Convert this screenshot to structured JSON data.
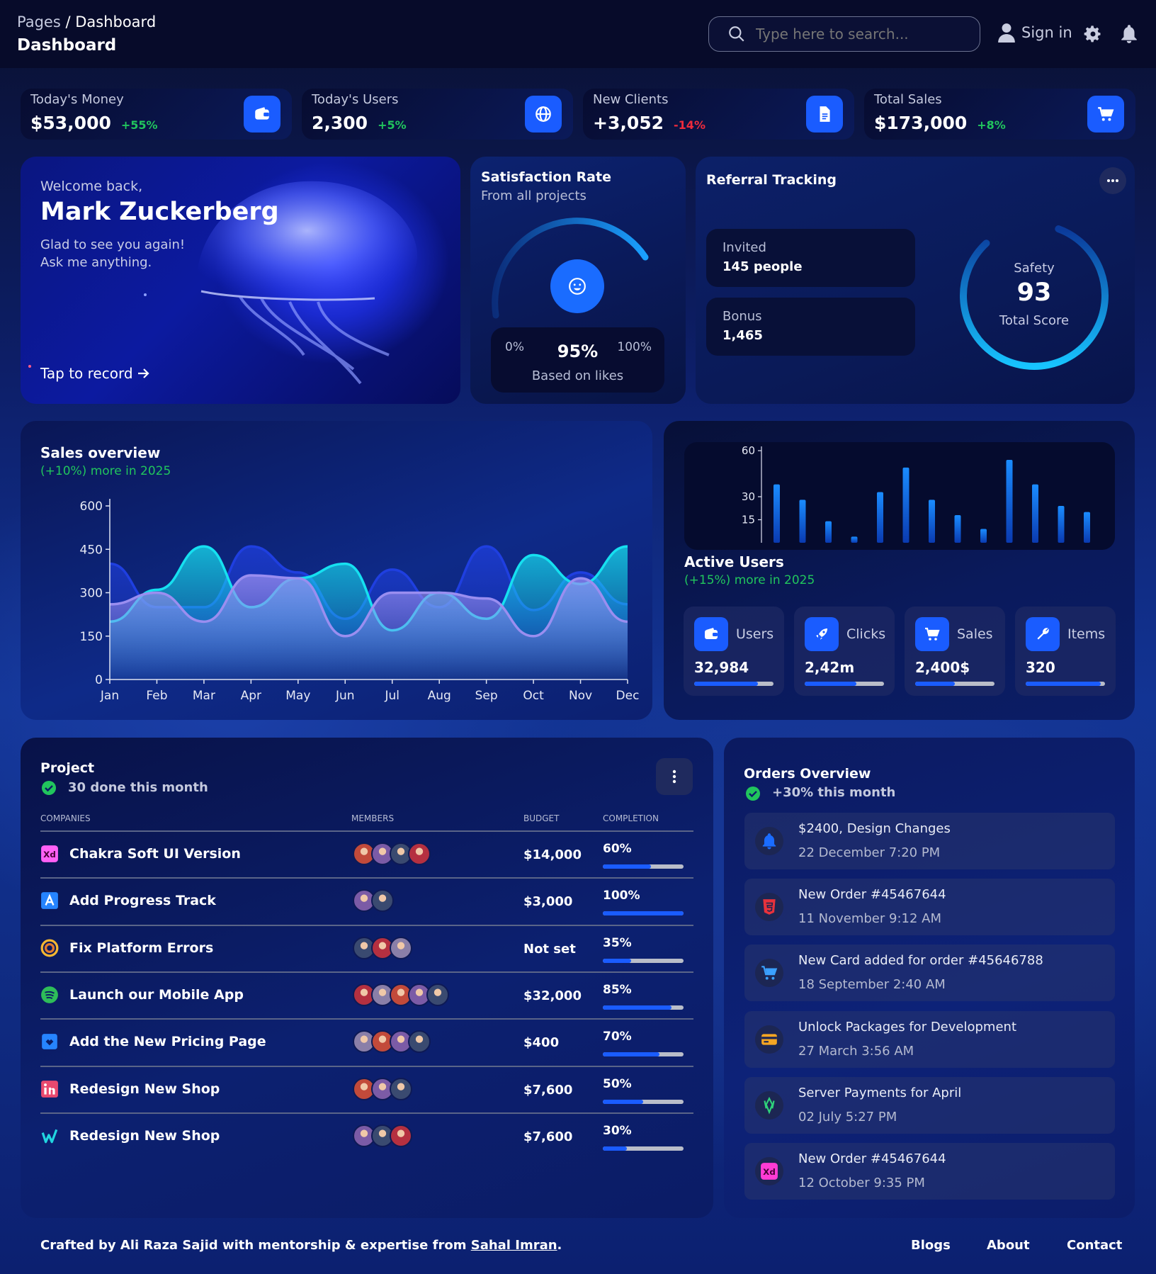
{
  "header": {
    "breadcrumb_parent": "Pages",
    "breadcrumb_sep": " / ",
    "breadcrumb_current": "Dashboard",
    "page_title": "Dashboard",
    "search_placeholder": "Type here to search...",
    "sign_in": "Sign in"
  },
  "kpis": [
    {
      "label": "Today's Money",
      "value": "$53,000",
      "change": "+55%",
      "trend": "up",
      "icon": "wallet-icon"
    },
    {
      "label": "Today's Users",
      "value": "2,300",
      "change": "+5%",
      "trend": "up",
      "icon": "globe-icon"
    },
    {
      "label": "New Clients",
      "value": "+3,052",
      "change": "-14%",
      "trend": "down",
      "icon": "document-icon"
    },
    {
      "label": "Total Sales",
      "value": "$173,000",
      "change": "+8%",
      "trend": "up",
      "icon": "cart-icon"
    }
  ],
  "welcome": {
    "greeting": "Welcome back,",
    "name": "Mark Zuckerberg",
    "line1": "Glad to see you again!",
    "line2": "Ask me anything.",
    "cta": "Tap to record"
  },
  "satisfaction": {
    "title": "Satisfaction Rate",
    "subtitle": "From all projects",
    "min": "0%",
    "value": "95%",
    "max": "100%",
    "caption": "Based on likes",
    "level": 0.95
  },
  "referral": {
    "title": "Referral Tracking",
    "invited_label": "Invited",
    "invited_value": "145 people",
    "bonus_label": "Bonus",
    "bonus_value": "1,465",
    "score_label": "Safety",
    "score": "93",
    "score_caption": "Total Score",
    "score_level": 0.93
  },
  "sales": {
    "title": "Sales overview",
    "subtitle": "(+10%) more in 2025"
  },
  "active": {
    "title": "Active Users",
    "subtitle": "(+15%) more in 2025",
    "stats": [
      {
        "label": "Users",
        "value": "32,984",
        "level": 0.8,
        "icon": "wallet-icon"
      },
      {
        "label": "Clicks",
        "value": "2,42m",
        "level": 0.65,
        "icon": "rocket-icon"
      },
      {
        "label": "Sales",
        "value": "2,400$",
        "level": 0.5,
        "icon": "cart-icon"
      },
      {
        "label": "Items",
        "value": "320",
        "level": 0.95,
        "icon": "wrench-icon"
      }
    ]
  },
  "chart_data": [
    {
      "type": "area",
      "categories": [
        "Jan",
        "Feb",
        "Mar",
        "Apr",
        "May",
        "Jun",
        "Jul",
        "Aug",
        "Sep",
        "Oct",
        "Nov",
        "Dec"
      ],
      "ylim": [
        0,
        600
      ],
      "yticks": [
        0,
        150,
        300,
        450,
        600
      ],
      "series": [
        {
          "values": [
            400,
            250,
            250,
            460,
            370,
            210,
            380,
            250,
            460,
            240,
            370,
            260
          ],
          "color": "#1f3fe0"
        },
        {
          "values": [
            200,
            310,
            460,
            250,
            350,
            400,
            170,
            300,
            210,
            430,
            330,
            460
          ],
          "color": "#16e0f0"
        },
        {
          "values": [
            260,
            300,
            200,
            360,
            350,
            150,
            300,
            300,
            280,
            150,
            350,
            200
          ],
          "color": "#9a8ef0"
        }
      ]
    },
    {
      "type": "bar",
      "ylim": [
        0,
        60
      ],
      "yticks": [
        15,
        30,
        60
      ],
      "values": [
        38,
        28,
        14,
        4,
        33,
        49,
        28,
        18,
        9,
        54,
        38,
        24,
        20
      ],
      "color": "#1a7cff"
    }
  ],
  "projects": {
    "title": "Project",
    "subtitle": "30 done this month",
    "headers": [
      "COMPANIES",
      "MEMBERS",
      "BUDGET",
      "COMPLETION"
    ],
    "rows": [
      {
        "name": "Chakra Soft UI Version",
        "budget": "$14,000",
        "completion": "60%",
        "level": 0.6,
        "members": 4,
        "icon": "xd-icon"
      },
      {
        "name": "Add Progress Track",
        "budget": "$3,000",
        "completion": "100%",
        "level": 1.0,
        "members": 2,
        "icon": "atlassian-icon"
      },
      {
        "name": "Fix Platform Errors",
        "budget": "Not set",
        "completion": "35%",
        "level": 0.35,
        "members": 3,
        "icon": "slack-icon"
      },
      {
        "name": "Launch our Mobile App",
        "budget": "$32,000",
        "completion": "85%",
        "level": 0.85,
        "members": 5,
        "icon": "spotify-icon"
      },
      {
        "name": "Add the New Pricing Page",
        "budget": "$400",
        "completion": "70%",
        "level": 0.7,
        "members": 4,
        "icon": "jira-icon"
      },
      {
        "name": "Redesign New Shop",
        "budget": "$7,600",
        "completion": "50%",
        "level": 0.5,
        "members": 3,
        "icon": "linkedin-icon"
      },
      {
        "name": "Redesign New Shop",
        "budget": "$7,600",
        "completion": "30%",
        "level": 0.3,
        "members": 3,
        "icon": "invision-icon"
      }
    ]
  },
  "orders": {
    "title": "Orders Overview",
    "subtitle": "+30% this month",
    "items": [
      {
        "title": "$2400, Design Changes",
        "date": "22 December 7:20 PM",
        "icon": "bell-icon",
        "color": "#1a6cff"
      },
      {
        "title": "New Order #45467644",
        "date": "11 November 9:12 AM",
        "icon": "html5-icon",
        "color": "#e8323c"
      },
      {
        "title": "New Card added for order #45646788",
        "date": "18 September 2:40 AM",
        "icon": "cart-icon",
        "color": "#3aa0ff"
      },
      {
        "title": "Unlock Packages for Development",
        "date": "27 March 3:56 AM",
        "icon": "credit-card-icon",
        "color": "#f5a623"
      },
      {
        "title": "Server Payments for April",
        "date": "02 July 5:27 PM",
        "icon": "server-icon",
        "color": "#2fd27a"
      },
      {
        "title": "New Order #45467644",
        "date": "12 October 9:35 PM",
        "icon": "xd-icon",
        "color": "#ff3bd4"
      }
    ]
  },
  "footer": {
    "credit": "Crafted by Ali Raza Sajid with mentorship & expertise from ",
    "link": "Sahal Imran",
    "period": ".",
    "links": [
      "Blogs",
      "About",
      "Contact"
    ]
  }
}
